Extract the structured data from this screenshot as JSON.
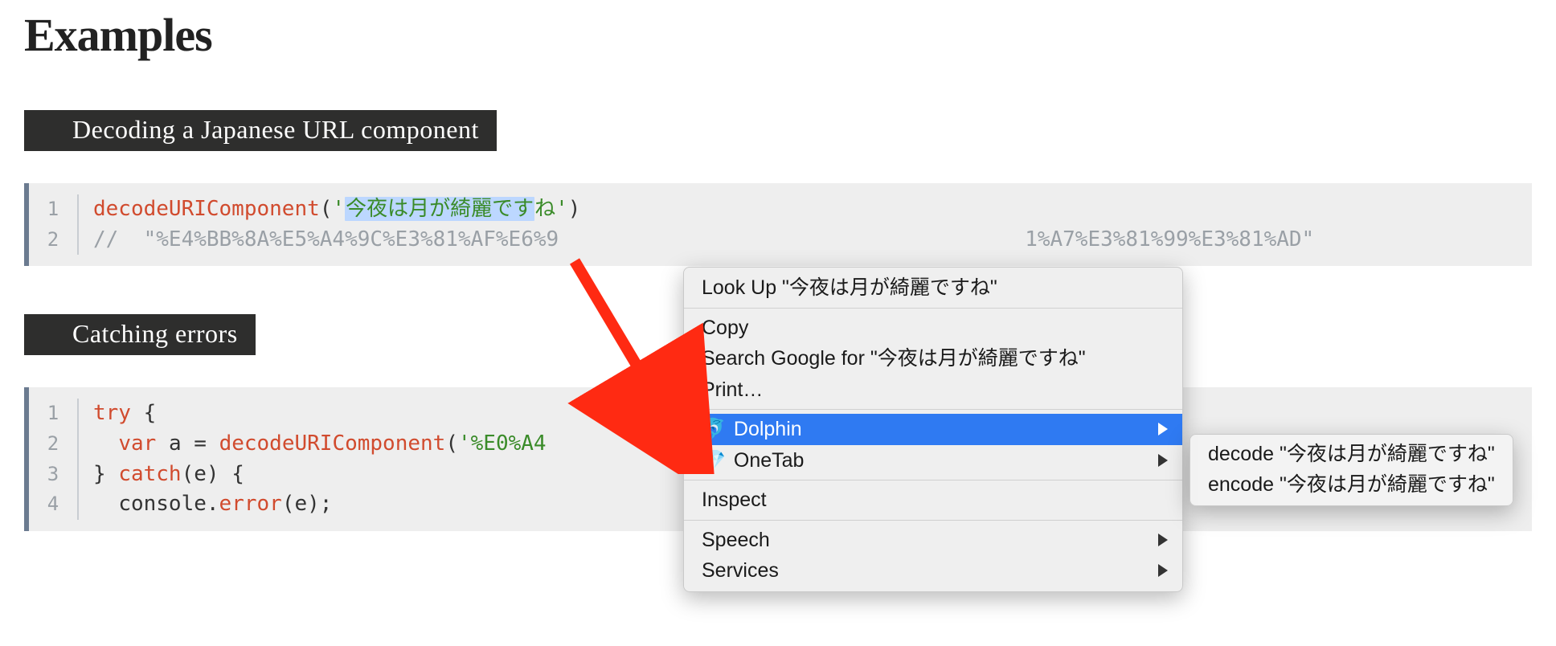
{
  "heading": "Examples",
  "section1": {
    "title": "Decoding a Japanese URL component",
    "code": {
      "line1": {
        "fn": "decodeURIComponent",
        "open": "(",
        "q1": "'",
        "selected_text": "今夜は月が綺麗です",
        "tail_str": "ね",
        "q2": "'",
        "close": ")"
      },
      "line2_a": "//  \"%E4%BB%8A%E5%A4%9C%E3%81%AF%E6%9",
      "line2_b": "1%A7%E3%81%99%E3%81%AD\""
    }
  },
  "section2": {
    "title": "Catching errors",
    "code": {
      "l1_kw": "try",
      "l1_rest": " {",
      "l2_indent": "  ",
      "l2_var": "var",
      "l2_sp": " ",
      "l2_a": "a",
      "l2_eq": " = ",
      "l2_fn": "decodeURIComponent",
      "l2_open": "(",
      "l2_str": "'%E0%A4",
      "l3_a": "} ",
      "l3_catch": "catch",
      "l3_rest": "(e) {",
      "l4_indent": "  ",
      "l4_console": "console",
      "l4_dot": ".",
      "l4_error": "error",
      "l4_rest": "(e);"
    }
  },
  "contextMenu": {
    "lookup": "Look Up \"今夜は月が綺麗ですね\"",
    "copy": "Copy",
    "searchGoogle": "Search Google for \"今夜は月が綺麗ですね\"",
    "print": "Print…",
    "dolphin": "Dolphin",
    "onetab": "OneTab",
    "inspect": "Inspect",
    "speech": "Speech",
    "services": "Services"
  },
  "submenu": {
    "decode": "decode \"今夜は月が綺麗ですね\"",
    "encode": "encode \"今夜は月が綺麗ですね\""
  }
}
